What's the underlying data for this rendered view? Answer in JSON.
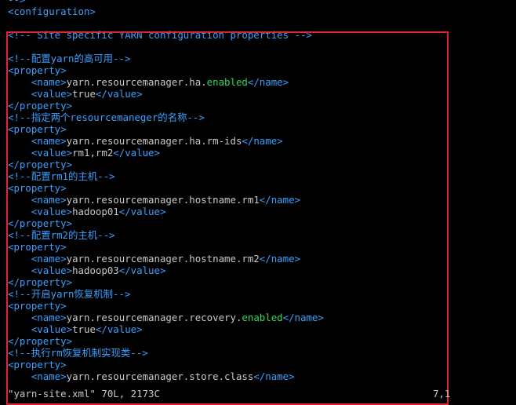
{
  "editor": {
    "colors": {
      "background": "#000000",
      "comment": "#3aa0ff",
      "tag": "#3aa0ff",
      "text": "#c8c8c8",
      "highlight": "#33d75a",
      "selection_box": "#e0262c"
    },
    "lines": [
      [
        {
          "t": "-->",
          "c": "comment"
        }
      ],
      [
        {
          "t": "<configuration>",
          "c": "tag"
        }
      ],
      [],
      [
        {
          "t": "<!-- Site specific YARN configuration properties -->",
          "c": "comment"
        }
      ],
      [],
      [
        {
          "t": "<!--配置yarn的高可用-->",
          "c": "comment"
        }
      ],
      [
        {
          "t": "<property>",
          "c": "tag"
        }
      ],
      [
        {
          "t": "    ",
          "c": "text"
        },
        {
          "t": "<name>",
          "c": "tag"
        },
        {
          "t": "yarn.resourcemanager.ha.",
          "c": "text"
        },
        {
          "t": "enabled",
          "c": "hl"
        },
        {
          "t": "</name>",
          "c": "tag"
        }
      ],
      [
        {
          "t": "    ",
          "c": "text"
        },
        {
          "t": "<value>",
          "c": "tag"
        },
        {
          "t": "true",
          "c": "text"
        },
        {
          "t": "</value>",
          "c": "tag"
        }
      ],
      [
        {
          "t": "</property>",
          "c": "tag"
        }
      ],
      [
        {
          "t": "<!--指定两个resourcemaneger的名称-->",
          "c": "comment"
        }
      ],
      [
        {
          "t": "<property>",
          "c": "tag"
        }
      ],
      [
        {
          "t": "    ",
          "c": "text"
        },
        {
          "t": "<name>",
          "c": "tag"
        },
        {
          "t": "yarn.resourcemanager.ha.rm-ids",
          "c": "text"
        },
        {
          "t": "</name>",
          "c": "tag"
        }
      ],
      [
        {
          "t": "    ",
          "c": "text"
        },
        {
          "t": "<value>",
          "c": "tag"
        },
        {
          "t": "rm1,rm2",
          "c": "text"
        },
        {
          "t": "</value>",
          "c": "tag"
        }
      ],
      [
        {
          "t": "</property>",
          "c": "tag"
        }
      ],
      [
        {
          "t": "<!--配置rm1的主机-->",
          "c": "comment"
        }
      ],
      [
        {
          "t": "<property>",
          "c": "tag"
        }
      ],
      [
        {
          "t": "    ",
          "c": "text"
        },
        {
          "t": "<name>",
          "c": "tag"
        },
        {
          "t": "yarn.resourcemanager.hostname.rm1",
          "c": "text"
        },
        {
          "t": "</name>",
          "c": "tag"
        }
      ],
      [
        {
          "t": "    ",
          "c": "text"
        },
        {
          "t": "<value>",
          "c": "tag"
        },
        {
          "t": "hadoop01",
          "c": "text"
        },
        {
          "t": "</value>",
          "c": "tag"
        }
      ],
      [
        {
          "t": "</property>",
          "c": "tag"
        }
      ],
      [
        {
          "t": "<!--配置rm2的主机-->",
          "c": "comment"
        }
      ],
      [
        {
          "t": "<property>",
          "c": "tag"
        }
      ],
      [
        {
          "t": "    ",
          "c": "text"
        },
        {
          "t": "<name>",
          "c": "tag"
        },
        {
          "t": "yarn.resourcemanager.hostname.rm2",
          "c": "text"
        },
        {
          "t": "</name>",
          "c": "tag"
        }
      ],
      [
        {
          "t": "    ",
          "c": "text"
        },
        {
          "t": "<value>",
          "c": "tag"
        },
        {
          "t": "hadoop03",
          "c": "text"
        },
        {
          "t": "</value>",
          "c": "tag"
        }
      ],
      [
        {
          "t": "</property>",
          "c": "tag"
        }
      ],
      [
        {
          "t": "<!--开启yarn恢复机制-->",
          "c": "comment"
        }
      ],
      [
        {
          "t": "<property>",
          "c": "tag"
        }
      ],
      [
        {
          "t": "    ",
          "c": "text"
        },
        {
          "t": "<name>",
          "c": "tag"
        },
        {
          "t": "yarn.resourcemanager.recovery.",
          "c": "text"
        },
        {
          "t": "enabled",
          "c": "hl"
        },
        {
          "t": "</name>",
          "c": "tag"
        }
      ],
      [
        {
          "t": "    ",
          "c": "text"
        },
        {
          "t": "<value>",
          "c": "tag"
        },
        {
          "t": "true",
          "c": "text"
        },
        {
          "t": "</value>",
          "c": "tag"
        }
      ],
      [
        {
          "t": "</property>",
          "c": "tag"
        }
      ],
      [
        {
          "t": "<!--执行rm恢复机制实现类-->",
          "c": "comment"
        }
      ],
      [
        {
          "t": "<property>",
          "c": "tag"
        }
      ],
      [
        {
          "t": "    ",
          "c": "text"
        },
        {
          "t": "<name>",
          "c": "tag"
        },
        {
          "t": "yarn.resourcemanager.store.class",
          "c": "text"
        },
        {
          "t": "</name>",
          "c": "tag"
        }
      ]
    ],
    "status": {
      "file_info": "\"yarn-site.xml\" 70L, 2173C",
      "cursor": "7,1"
    }
  }
}
